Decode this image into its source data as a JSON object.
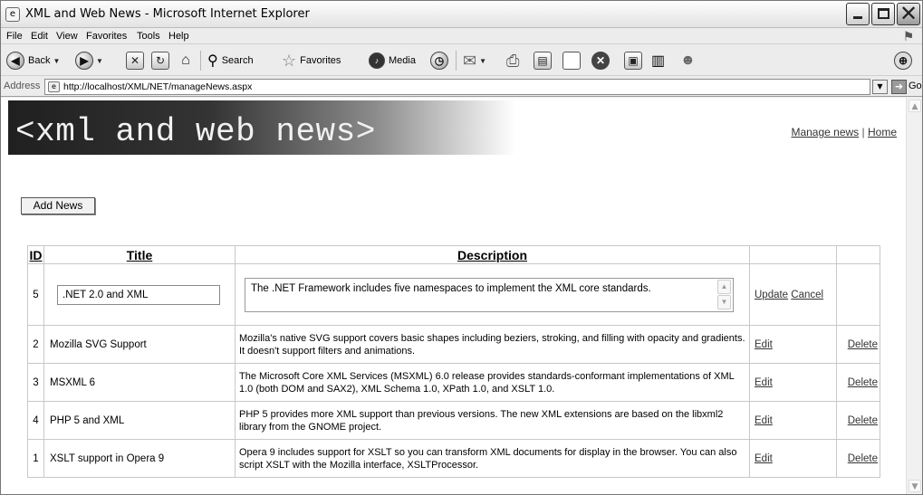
{
  "window": {
    "title": "XML and Web News - Microsoft Internet Explorer"
  },
  "menubar": {
    "items": [
      "File",
      "Edit",
      "View",
      "Favorites",
      "Tools",
      "Help"
    ]
  },
  "toolbar": {
    "back_label": "Back",
    "search_label": "Search",
    "favorites_label": "Favorites",
    "media_label": "Media"
  },
  "address": {
    "label": "Address",
    "url": "http://localhost/XML/NET/manageNews.aspx",
    "go_label": "Go"
  },
  "page": {
    "logo_text": "<xml and web news>",
    "nav": {
      "manage_news": "Manage news",
      "separator": "|",
      "home": "Home"
    },
    "add_news_label": "Add News"
  },
  "table": {
    "headers": {
      "id": "ID",
      "title": "Title",
      "description": "Description"
    },
    "edit_row": {
      "id": "5",
      "title": ".NET 2.0 and XML",
      "description": "The .NET Framework includes five namespaces to implement the XML core standards.",
      "update_label": "Update",
      "cancel_label": "Cancel"
    },
    "rows": [
      {
        "id": "2",
        "title": "Mozilla SVG Support",
        "description": "Mozilla's native SVG support covers basic shapes including beziers, stroking, and filling with opacity and gradients. It doesn't support filters and animations.",
        "edit": "Edit",
        "delete": "Delete"
      },
      {
        "id": "3",
        "title": "MSXML 6",
        "description": "The Microsoft Core XML Services (MSXML) 6.0 release provides standards-conformant implementations of XML 1.0 (both DOM and SAX2), XML Schema 1.0, XPath 1.0, and XSLT 1.0.",
        "edit": "Edit",
        "delete": "Delete"
      },
      {
        "id": "4",
        "title": "PHP 5 and XML",
        "description": "PHP 5 provides more XML support than previous versions. The new XML extensions are based on the libxml2 library from the GNOME project.",
        "edit": "Edit",
        "delete": "Delete"
      },
      {
        "id": "1",
        "title": "XSLT support in Opera 9",
        "description": "Opera 9 includes support for XSLT so you can transform XML documents for display in the browser. You can also script XSLT with the Mozilla interface, XSLTProcessor.",
        "edit": "Edit",
        "delete": "Delete"
      }
    ]
  }
}
